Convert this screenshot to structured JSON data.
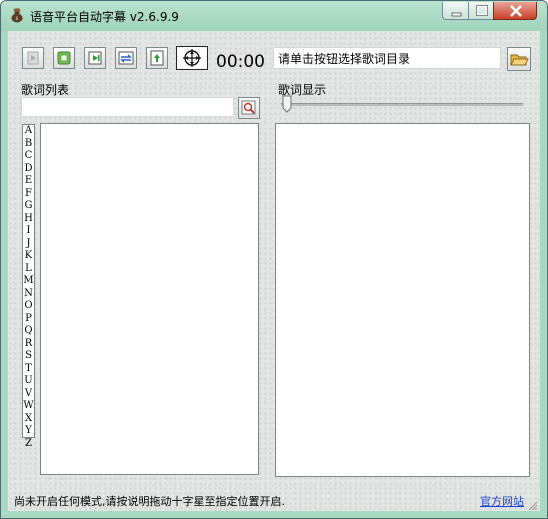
{
  "window": {
    "title": "语音平台自动字幕 v2.6.9.9",
    "icons": {
      "app": "sack-icon",
      "minimize": "minimize-icon",
      "maximize": "maximize-icon",
      "close": "close-icon"
    }
  },
  "toolbar": {
    "buttons": [
      {
        "name": "play-icon",
        "disabled": true
      },
      {
        "name": "stop-icon"
      },
      {
        "name": "next-track-icon"
      },
      {
        "name": "sync-arrows-icon"
      },
      {
        "name": "upload-arrow-icon"
      },
      {
        "name": "crosshair-icon"
      }
    ],
    "timer": "00:00",
    "directory_text": "请单击按钮选择歌词目录",
    "folder_icon": "open-folder-icon"
  },
  "left_panel": {
    "label": "歌词列表",
    "search_value": "",
    "search_icon": "search-icon",
    "letters": [
      "A",
      "B",
      "C",
      "D",
      "E",
      "F",
      "G",
      "H",
      "I",
      "J",
      "K",
      "L",
      "M",
      "N",
      "O",
      "P",
      "Q",
      "R",
      "S",
      "T",
      "U",
      "V",
      "W",
      "X",
      "Y",
      "Z"
    ]
  },
  "right_panel": {
    "label": "歌词显示",
    "slider_value": 0
  },
  "statusbar": {
    "message": "尚未开启任何模式,请按说明拖动十字星至指定位置开启.",
    "link": "官方网站"
  },
  "colors": {
    "frame": "#a8d9c3",
    "client": "#e3e6e4",
    "link": "#1c3fcf",
    "close": "#c8402a"
  }
}
